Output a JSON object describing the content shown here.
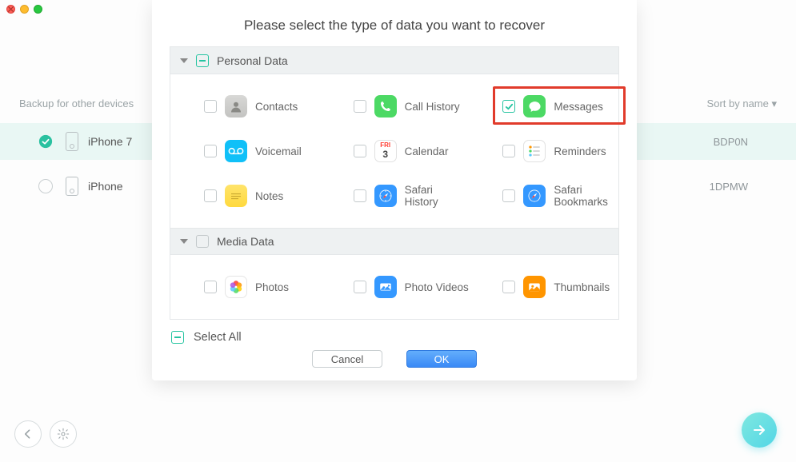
{
  "traffic_lights": {
    "close": "●",
    "min": "●",
    "max": "●"
  },
  "bg": {
    "backup_label": "Backup for other devices",
    "sort_label": "Sort by name ▾",
    "devices": [
      {
        "name": "iPhone 7",
        "serial": "BDP0N",
        "selected": true
      },
      {
        "name": "iPhone",
        "serial": "1DPMW",
        "selected": false
      }
    ]
  },
  "modal": {
    "title": "Please select the type of data you want to recover",
    "sections": [
      {
        "title": "Personal Data",
        "state": "indeterminate",
        "items": [
          {
            "key": "contacts",
            "label": "Contacts",
            "checked": false
          },
          {
            "key": "call-history",
            "label": "Call History",
            "checked": false
          },
          {
            "key": "messages",
            "label": "Messages",
            "checked": true,
            "highlighted": true
          },
          {
            "key": "voicemail",
            "label": "Voicemail",
            "checked": false
          },
          {
            "key": "calendar",
            "label": "Calendar",
            "checked": false
          },
          {
            "key": "reminders",
            "label": "Reminders",
            "checked": false
          },
          {
            "key": "notes",
            "label": "Notes",
            "checked": false
          },
          {
            "key": "safari-history",
            "label": "Safari History",
            "checked": false
          },
          {
            "key": "safari-bookmarks",
            "label": "Safari Bookmarks",
            "checked": false
          }
        ]
      },
      {
        "title": "Media Data",
        "state": "unchecked",
        "items": [
          {
            "key": "photos",
            "label": "Photos",
            "checked": false
          },
          {
            "key": "photo-videos",
            "label": "Photo Videos",
            "checked": false
          },
          {
            "key": "thumbnails",
            "label": "Thumbnails",
            "checked": false
          }
        ]
      }
    ],
    "select_all_label": "Select All",
    "select_all_state": "indeterminate",
    "cancel_label": "Cancel",
    "ok_label": "OK"
  },
  "calendar_icon": {
    "top": "FRI",
    "day": "3"
  }
}
